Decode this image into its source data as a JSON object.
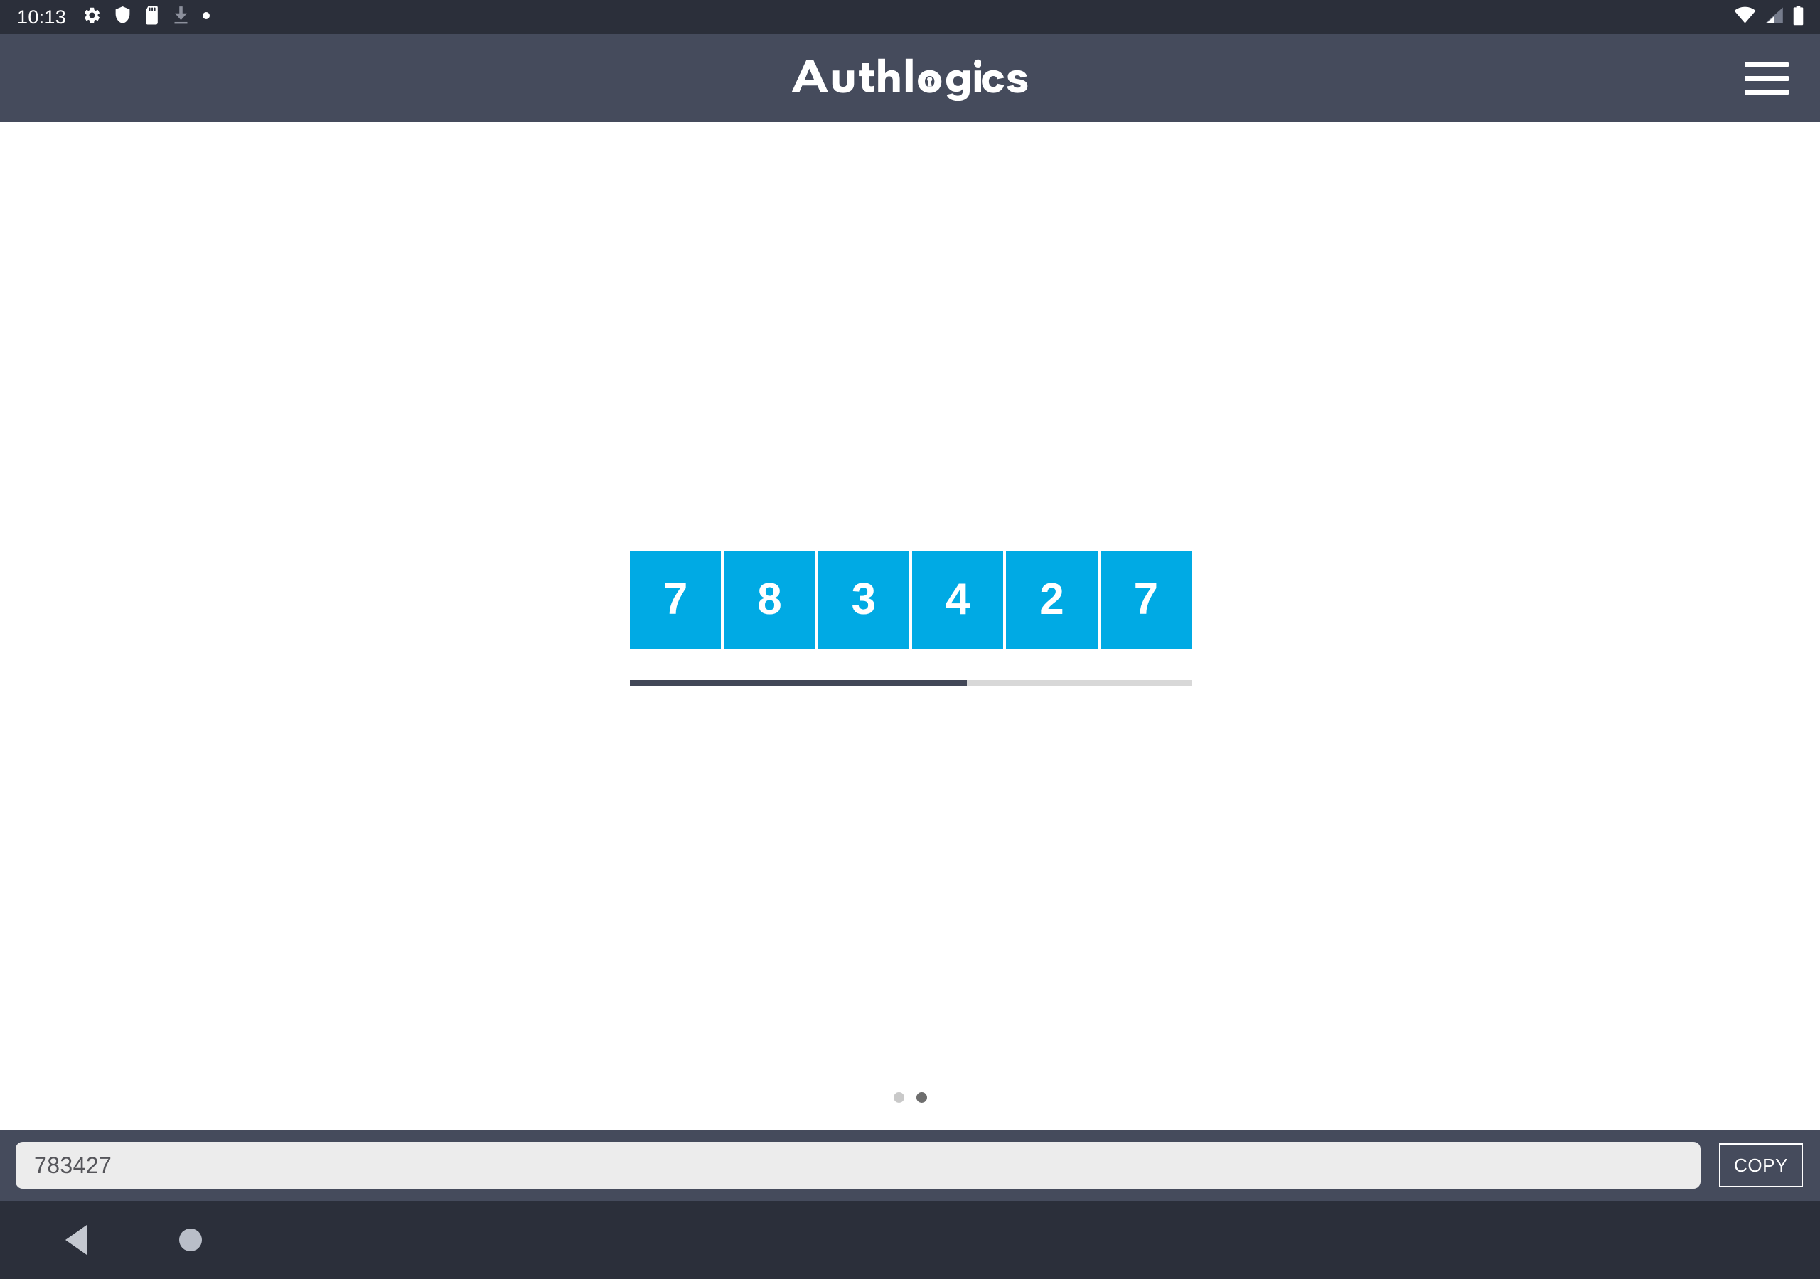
{
  "status_bar": {
    "clock": "10:13",
    "left_icons": [
      {
        "name": "gear-icon",
        "state": "active"
      },
      {
        "name": "shield-icon",
        "state": "active"
      },
      {
        "name": "sd-card-icon",
        "state": "active"
      },
      {
        "name": "download-icon",
        "state": "dimmed"
      },
      {
        "name": "dot-icon",
        "state": "active"
      }
    ],
    "right_icons": [
      {
        "name": "wifi-icon",
        "state": "full"
      },
      {
        "name": "cellular-signal-icon",
        "state": "partial"
      },
      {
        "name": "battery-icon",
        "state": "full"
      }
    ],
    "background_color": "#2b2f3a"
  },
  "header": {
    "brand": "Authlogics",
    "logo_icon": "keyhole-icon",
    "menu_icon": "hamburger-menu-icon",
    "background_color": "#454b5c"
  },
  "main": {
    "otp": {
      "digits": [
        "7",
        "8",
        "3",
        "4",
        "2",
        "7"
      ],
      "tile_color": "#00aae4",
      "digit_color": "#ffffff"
    },
    "progress": {
      "percent": 60,
      "fill_color": "#424757",
      "track_color": "#d8d8d8"
    },
    "pagination": {
      "pages": 2,
      "active_index": 1,
      "active_color": "#6e6e6e",
      "inactive_color": "#c9c9c9"
    },
    "background_color": "#ffffff"
  },
  "copy_bar": {
    "code_value": "783427",
    "code_placeholder": "",
    "copy_label": "COPY",
    "background_color": "#454b5c"
  },
  "nav_bar": {
    "back_icon": "back-triangle-icon",
    "home_icon": "home-circle-icon",
    "background_color": "#2b2f3a"
  }
}
